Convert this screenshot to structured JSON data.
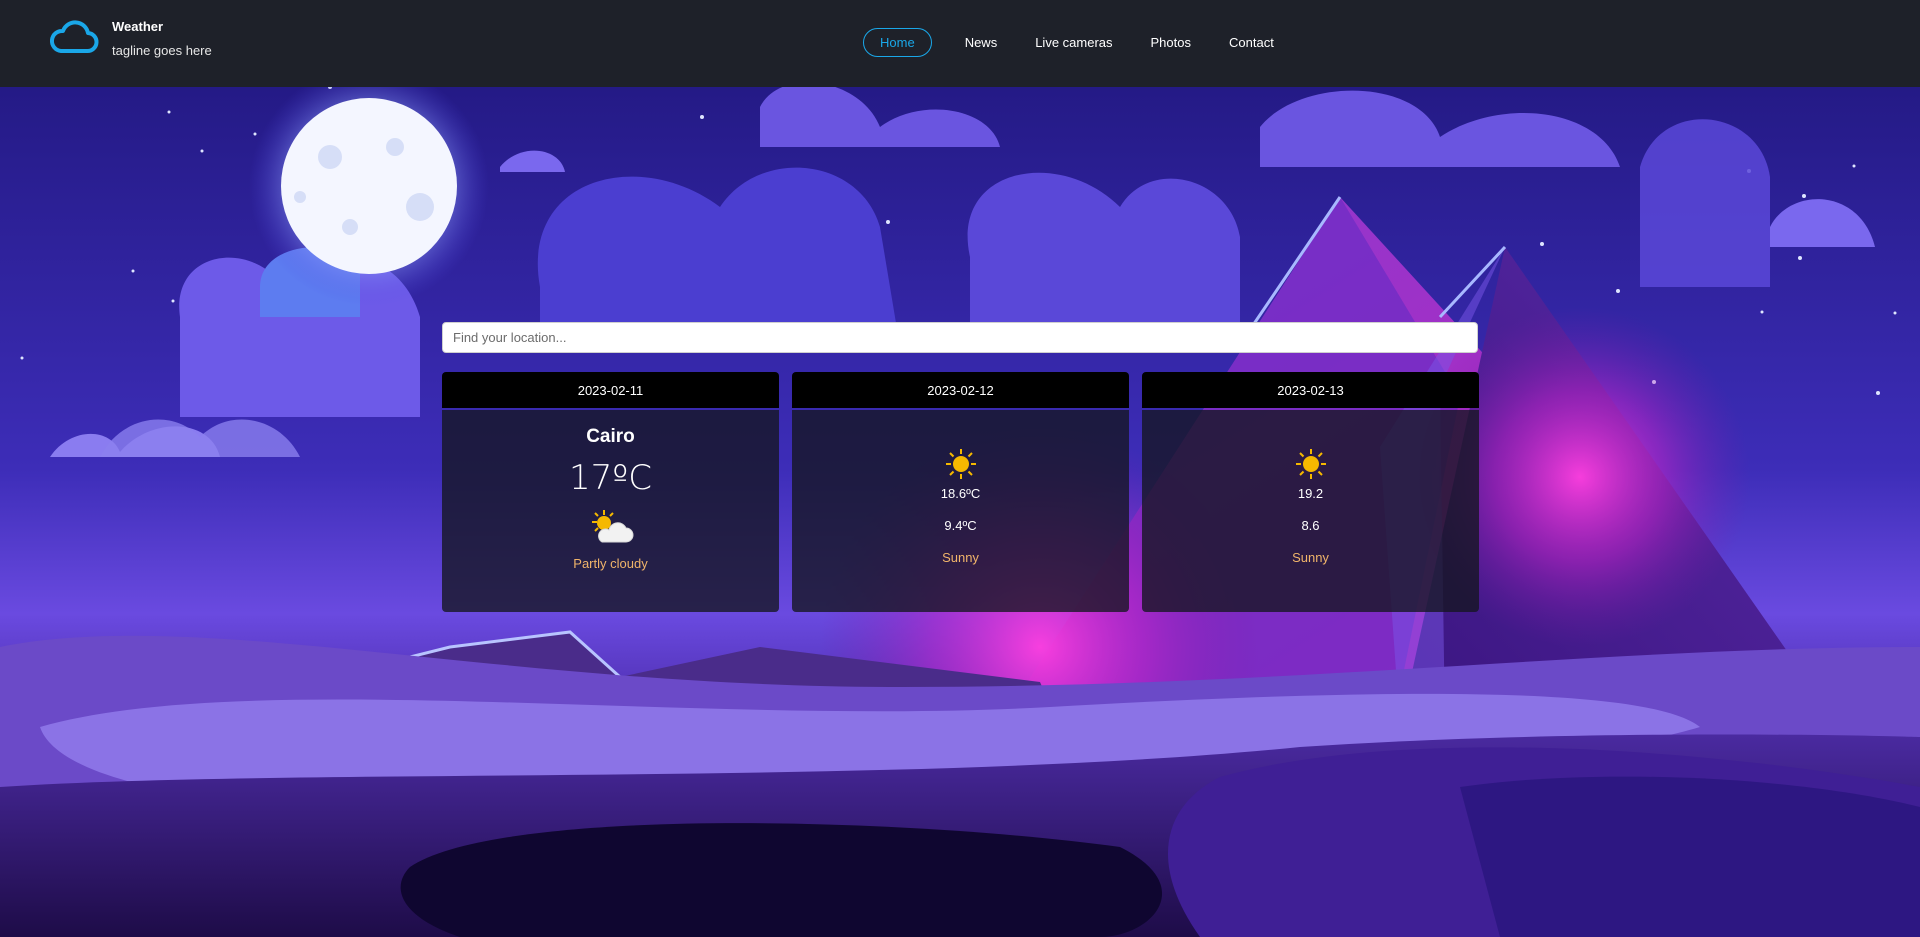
{
  "brand": {
    "name": "Weather",
    "tagline": "tagline goes here",
    "icon": "cloud-icon",
    "accent": "#1aa7e8"
  },
  "nav": {
    "items": [
      "Home",
      "News",
      "Live cameras",
      "Photos",
      "Contact"
    ],
    "active": "Home"
  },
  "search": {
    "placeholder": "Find your location..."
  },
  "forecast": {
    "today": {
      "date": "2023-02-11",
      "city": "Cairo",
      "temperature": "17ºC",
      "condition": "Partly cloudy",
      "icon": "partly-cloudy-icon"
    },
    "day2": {
      "date": "2023-02-12",
      "max_temp": "18.6ºC",
      "min_temp": "9.4ºC",
      "condition": "Sunny",
      "icon": "sun-icon"
    },
    "day3": {
      "date": "2023-02-13",
      "max_temp": "19.2",
      "min_temp": "8.6",
      "condition": "Sunny",
      "icon": "sun-icon"
    }
  },
  "colors": {
    "header_bg": "#1e2129",
    "condition_text": "#f0b46a",
    "sun": "#f5b800"
  }
}
